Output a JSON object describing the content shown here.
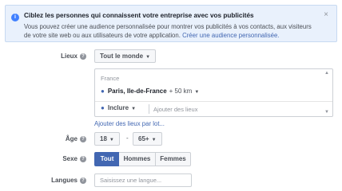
{
  "notice": {
    "title": "Ciblez les personnes qui connaissent votre entreprise avec vos publicités",
    "body": "Vous pouvez créer une audience personnalisée pour montrer vos publicités à vos contacts, aux visiteurs de votre site web ou aux utilisateurs de votre application.",
    "link": "Créer une audience personnalisée.",
    "close": "×"
  },
  "locations": {
    "label": "Lieux",
    "dropdown": "Tout le monde",
    "country": "France",
    "city": "Paris, Ile-de-France",
    "radius": "+ 50 km",
    "include": "Inclure",
    "search_placeholder": "Ajouter des lieux",
    "bulk_link": "Ajouter des lieux par lot..."
  },
  "age": {
    "label": "Âge",
    "min": "18",
    "dash": "-",
    "max": "65+"
  },
  "gender": {
    "label": "Sexe",
    "options": [
      "Tout",
      "Hommes",
      "Femmes"
    ],
    "selected": "Tout"
  },
  "languages": {
    "label": "Langues",
    "placeholder": "Saisissez une langue..."
  },
  "colors": {
    "accent": "#4267b2",
    "notice_bg": "#e9f1fc"
  }
}
